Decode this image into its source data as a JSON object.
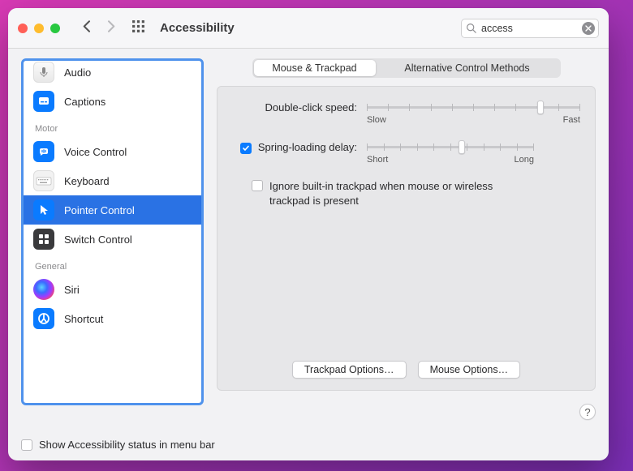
{
  "window": {
    "title": "Accessibility"
  },
  "search": {
    "value": "access",
    "placeholder": "Search"
  },
  "sidebar": {
    "groups": [
      {
        "label": "",
        "items": [
          {
            "label": "Audio",
            "icon": "audio"
          },
          {
            "label": "Captions",
            "icon": "captions"
          }
        ]
      },
      {
        "label": "Motor",
        "items": [
          {
            "label": "Voice Control",
            "icon": "voice-control"
          },
          {
            "label": "Keyboard",
            "icon": "keyboard"
          },
          {
            "label": "Pointer Control",
            "icon": "pointer-control",
            "selected": true
          },
          {
            "label": "Switch Control",
            "icon": "switch-control"
          }
        ]
      },
      {
        "label": "General",
        "items": [
          {
            "label": "Siri",
            "icon": "siri"
          },
          {
            "label": "Shortcut",
            "icon": "shortcut"
          }
        ]
      }
    ]
  },
  "tabs": {
    "active": 0,
    "items": [
      "Mouse & Trackpad",
      "Alternative Control Methods"
    ]
  },
  "pane": {
    "double_click": {
      "label": "Double-click speed:",
      "min_label": "Slow",
      "max_label": "Fast",
      "value": 0.8
    },
    "spring": {
      "enabled": true,
      "label": "Spring-loading delay:",
      "min_label": "Short",
      "max_label": "Long",
      "value": 0.55
    },
    "ignore_trackpad": {
      "enabled": false,
      "label": "Ignore built-in trackpad when mouse or wireless trackpad is present"
    },
    "buttons": {
      "trackpad": "Trackpad Options…",
      "mouse": "Mouse Options…"
    }
  },
  "footer": {
    "show_menu_bar": {
      "checked": false,
      "label": "Show Accessibility status in menu bar"
    }
  },
  "help": "?"
}
